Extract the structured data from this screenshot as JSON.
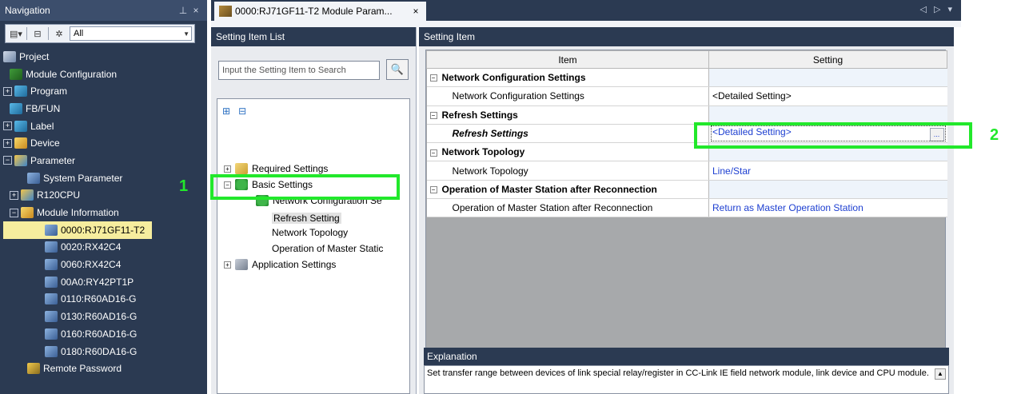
{
  "navigation": {
    "title": "Navigation",
    "pin_icon": "pin-icon",
    "close_glyph": "×",
    "filter_value": "All",
    "tree": [
      {
        "label": "Project",
        "icon": "project-icon",
        "expander": "",
        "indent": 0
      },
      {
        "label": "Module Configuration",
        "icon": "module-config-icon",
        "expander": "",
        "indent": 1
      },
      {
        "label": "Program",
        "icon": "program-icon",
        "expander": "+",
        "indent": 0
      },
      {
        "label": "FB/FUN",
        "icon": "fb-fun-icon",
        "expander": "",
        "indent": 1
      },
      {
        "label": "Label",
        "icon": "label-icon",
        "expander": "+",
        "indent": 0
      },
      {
        "label": "Device",
        "icon": "device-icon",
        "expander": "+",
        "indent": 0
      },
      {
        "label": "Parameter",
        "icon": "parameter-icon",
        "expander": "−",
        "indent": 0
      },
      {
        "label": "System Parameter",
        "icon": "system-parameter-icon",
        "expander": "",
        "indent": 2
      },
      {
        "label": "R120CPU",
        "icon": "cpu-icon",
        "expander": "+",
        "indent": 1
      },
      {
        "label": "Module Information",
        "icon": "module-info-icon",
        "expander": "−",
        "indent": 1
      },
      {
        "label": "0000:RJ71GF11-T2",
        "icon": "module-icon",
        "expander": "",
        "indent": 3,
        "selected": true
      },
      {
        "label": "0020:RX42C4",
        "icon": "module-icon",
        "expander": "",
        "indent": 3
      },
      {
        "label": "0060:RX42C4",
        "icon": "module-icon",
        "expander": "",
        "indent": 3
      },
      {
        "label": "00A0:RY42PT1P",
        "icon": "module-icon",
        "expander": "",
        "indent": 3
      },
      {
        "label": "0110:R60AD16-G",
        "icon": "module-icon",
        "expander": "",
        "indent": 3
      },
      {
        "label": "0130:R60AD16-G",
        "icon": "module-icon",
        "expander": "",
        "indent": 3
      },
      {
        "label": "0160:R60AD16-G",
        "icon": "module-icon",
        "expander": "",
        "indent": 3
      },
      {
        "label": "0180:R60DA16-G",
        "icon": "module-icon",
        "expander": "",
        "indent": 3
      },
      {
        "label": "Remote Password",
        "icon": "remote-password-icon",
        "expander": "",
        "indent": 2
      }
    ]
  },
  "tab": {
    "label": "0000:RJ71GF11-T2 Module Param...",
    "close": "×",
    "nav_arrows": "◁ ▷ ▾"
  },
  "setting_item_list": {
    "title": "Setting Item List",
    "search_placeholder": "Input the Setting Item to Search",
    "search_icon": "binoculars-icon",
    "tree": [
      {
        "label": "Required Settings",
        "expander": "+",
        "icon": "folder"
      },
      {
        "label": "Basic Settings",
        "expander": "−",
        "icon": "check"
      },
      {
        "label": "Network Configuration Se",
        "expander": "",
        "icon": "check"
      },
      {
        "label": "Refresh Setting",
        "expander": "",
        "icon": "none",
        "selected": true
      },
      {
        "label": "Network Topology",
        "expander": "",
        "icon": "none"
      },
      {
        "label": "Operation of Master Static",
        "expander": "",
        "icon": "none"
      },
      {
        "label": "Application Settings",
        "expander": "+",
        "icon": "app"
      }
    ]
  },
  "setting_item": {
    "title": "Setting Item",
    "columns": [
      "Item",
      "Setting"
    ],
    "rows": [
      {
        "type": "category",
        "item": "Network Configuration Settings",
        "setting": ""
      },
      {
        "type": "item",
        "item": "Network Configuration Settings",
        "setting": "<Detailed Setting>",
        "blue": false
      },
      {
        "type": "category",
        "item": "Refresh Settings",
        "setting": ""
      },
      {
        "type": "item",
        "item": "Refresh Settings",
        "setting": "<Detailed Setting>",
        "blue": true,
        "selected": true,
        "italic": true
      },
      {
        "type": "category",
        "item": "Network Topology",
        "setting": ""
      },
      {
        "type": "item",
        "item": "Network Topology",
        "setting": "Line/Star",
        "blue": true
      },
      {
        "type": "category",
        "item": "Operation of Master Station after Reconnection",
        "setting": ""
      },
      {
        "type": "item",
        "item": "Operation of Master Station after Reconnection",
        "setting": "Return as Master Operation Station",
        "blue": true
      }
    ],
    "dots_button": "...",
    "explanation": {
      "title": "Explanation",
      "text": "Set transfer range between devices of link special relay/register in CC-Link IE field network module, link device and CPU module."
    }
  },
  "annotations": [
    {
      "number": "1"
    },
    {
      "number": "2"
    }
  ],
  "colors": {
    "highlight": "#22e82b",
    "panel_dark": "#2b3a52",
    "link_blue": "#1d3fd1",
    "selected_nav": "#f6ed9e"
  }
}
